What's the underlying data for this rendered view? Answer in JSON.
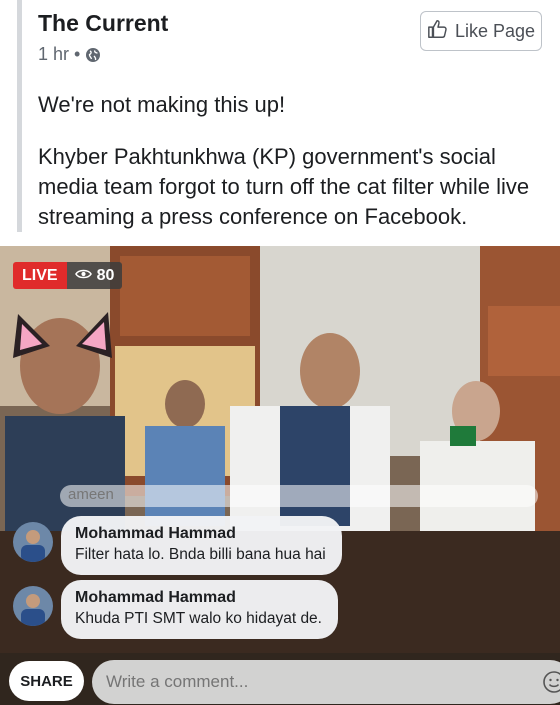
{
  "post": {
    "page_name": "The Current",
    "time": "1 hr",
    "separator": "•",
    "like_button_label": "Like Page",
    "paragraphs": [
      "We're not making this up!",
      "Khyber Pakhtunkhwa (KP) government's social media team forgot to turn off the cat filter while live streaming a press conference on Facebook."
    ]
  },
  "video": {
    "live_label": "LIVE",
    "viewer_count": "80",
    "faded_comment": "ameen",
    "comments": [
      {
        "author": "Mohammad Hammad",
        "text": "Filter hata lo. Bnda billi bana hua hai"
      },
      {
        "author": "Mohammad Hammad",
        "text": "Khuda PTI SMT walo ko hidayat de."
      }
    ],
    "share_label": "SHARE",
    "comment_placeholder": "Write a comment..."
  },
  "colors": {
    "live_red": "#e02b2b",
    "text_dark": "#1c1e21",
    "text_meta": "#606770"
  },
  "icons": [
    "globe-icon",
    "thumbs-up-icon",
    "eye-icon",
    "emoji-icon"
  ]
}
